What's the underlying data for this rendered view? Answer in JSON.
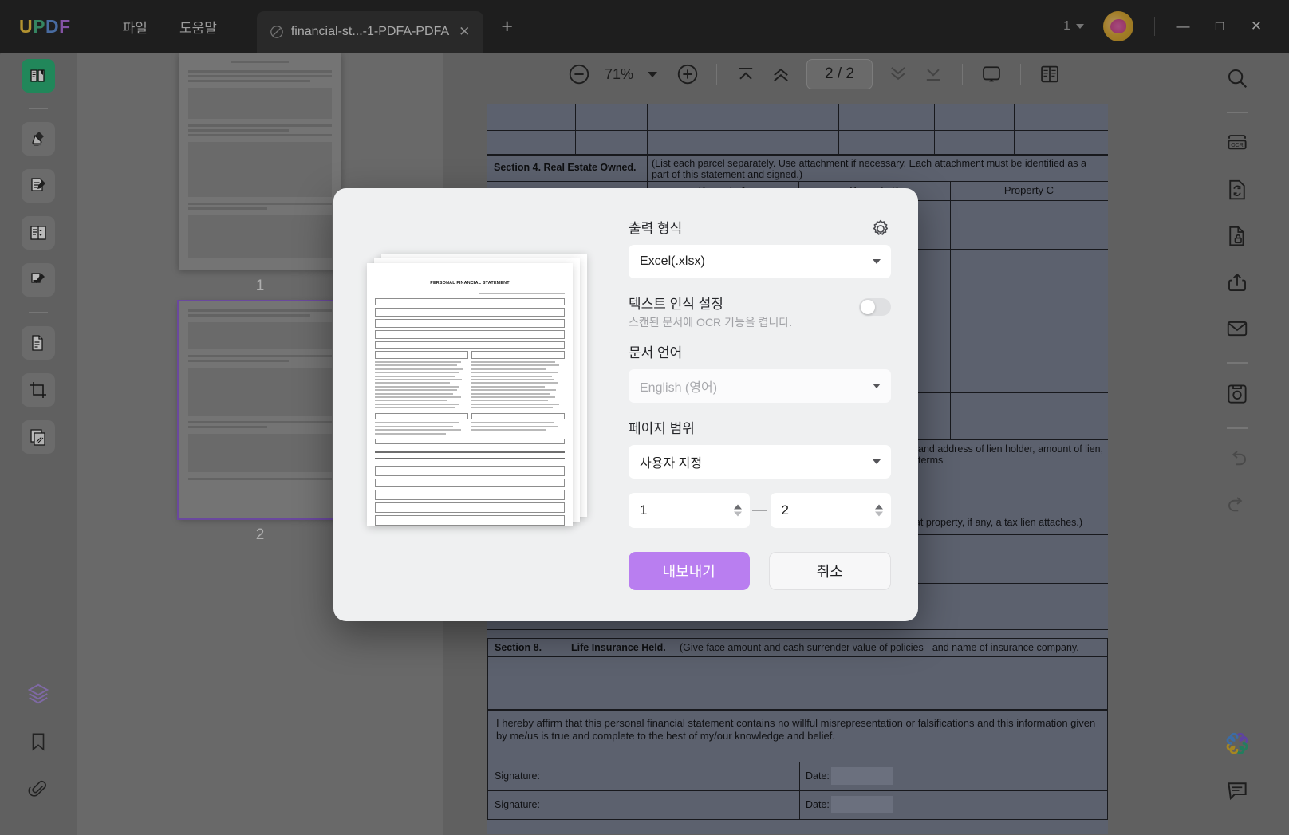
{
  "titlebar": {
    "logo": "UPDF",
    "menus": [
      {
        "label": "파일",
        "name": "menu-file"
      },
      {
        "label": "도움말",
        "name": "menu-help"
      }
    ],
    "tab": {
      "title": "financial-st...-1-PDFA-PDFA",
      "close": "✕",
      "doc_icon": "pdf-document-icon"
    },
    "new_tab": "+",
    "window_count": "1",
    "minimize": "—",
    "maximize": "□",
    "close": "✕"
  },
  "left_rail": {
    "items": [
      {
        "name": "sidebar-item-reader",
        "icon": "book-reader-icon",
        "active": true
      },
      {
        "name": "sidebar-item-highlight",
        "icon": "highlighter-icon",
        "active": false
      },
      {
        "name": "sidebar-item-edit-pdf",
        "icon": "edit-document-icon",
        "active": false
      },
      {
        "name": "sidebar-item-form",
        "icon": "form-fields-icon",
        "active": false
      },
      {
        "name": "sidebar-item-sign",
        "icon": "signature-icon",
        "active": false
      },
      {
        "name": "sidebar-item-organize-pages",
        "icon": "page-organize-icon",
        "active": false
      },
      {
        "name": "sidebar-item-crop",
        "icon": "crop-icon",
        "active": false
      },
      {
        "name": "sidebar-item-compare",
        "icon": "compare-pages-icon",
        "active": false
      }
    ],
    "bottom": [
      {
        "name": "sidebar-item-layers",
        "icon": "layers-icon"
      },
      {
        "name": "sidebar-item-bookmark",
        "icon": "bookmark-icon"
      },
      {
        "name": "sidebar-item-attachment",
        "icon": "paperclip-icon"
      }
    ]
  },
  "thumbnails": {
    "pages": [
      {
        "number": "1",
        "selected": false
      },
      {
        "number": "2",
        "selected": true
      }
    ]
  },
  "toolbar": {
    "zoom_out": "zoom-out-icon",
    "zoom_value": "71%",
    "zoom_in": "zoom-in-icon",
    "first_page": "first-page-icon",
    "prev_page": "previous-page-icon",
    "page_indicator": "2 / 2",
    "next_page": "next-page-icon",
    "last_page": "last-page-icon",
    "presentation": "presentation-mode-icon",
    "view_mode": "page-layout-icon"
  },
  "right_rail": {
    "items": [
      {
        "name": "tool-search",
        "icon": "search-icon"
      },
      {
        "name": "tool-ocr",
        "icon": "ocr-icon"
      },
      {
        "name": "tool-convert",
        "icon": "convert-document-icon"
      },
      {
        "name": "tool-protect",
        "icon": "document-lock-icon"
      },
      {
        "name": "tool-share",
        "icon": "share-icon"
      },
      {
        "name": "tool-email",
        "icon": "envelope-icon"
      },
      {
        "name": "tool-save",
        "icon": "save-icon"
      },
      {
        "name": "tool-undo",
        "icon": "undo-icon"
      },
      {
        "name": "tool-redo",
        "icon": "redo-icon"
      }
    ],
    "bottom": [
      {
        "name": "tool-ai-assistant",
        "icon": "ai-flower-icon"
      },
      {
        "name": "tool-comments",
        "icon": "comment-icon"
      }
    ]
  },
  "document": {
    "section4_title": "Section 4. Real Estate Owned.",
    "section4_note": "(List each parcel separately.  Use attachment if necessary.  Each attachment must be identified as a part of this statement and signed.)",
    "property_headers": [
      "Property A",
      "Property B",
      "Property C"
    ],
    "lien_note": "and address of lien holder, amount of lien, terms",
    "tax_lien_note": "what property, if any, a tax lien attaches.)",
    "section8_label": "Section 8.",
    "section8_title": "Life Insurance Held.",
    "section8_note": "(Give face amount and cash surrender value of policies - and name of insurance company.",
    "affirmation": "I hereby affirm that this personal financial statement contains no willful misrepresentation or falsifications and this information given by me/us is true and complete to the best of my/our knowledge and belief.",
    "signature_label": "Signature:",
    "date_label": "Date:",
    "preview_title": "PERSONAL FINANCIAL STATEMENT"
  },
  "dialog": {
    "settings_icon": "gear-icon",
    "output_format_label": "출력 형식",
    "output_format_value": "Excel(.xlsx)",
    "ocr_label": "텍스트 인식 설정",
    "ocr_enabled": false,
    "ocr_description": "스캔된 문서에 OCR 기능을 켭니다.",
    "language_label": "문서 언어",
    "language_placeholder": "English (영어)",
    "page_range_label": "페이지 범위",
    "page_range_value": "사용자 지정",
    "range_from": "1",
    "range_to": "2",
    "range_separator": "—",
    "export_button": "내보내기",
    "cancel_button": "취소"
  },
  "colors": {
    "accent_purple": "#b97ef0",
    "active_green": "#23b574",
    "titlebar_bg": "#1f1f1f",
    "app_bg": "#7d7d7d",
    "dialog_bg": "#eff0f1"
  }
}
